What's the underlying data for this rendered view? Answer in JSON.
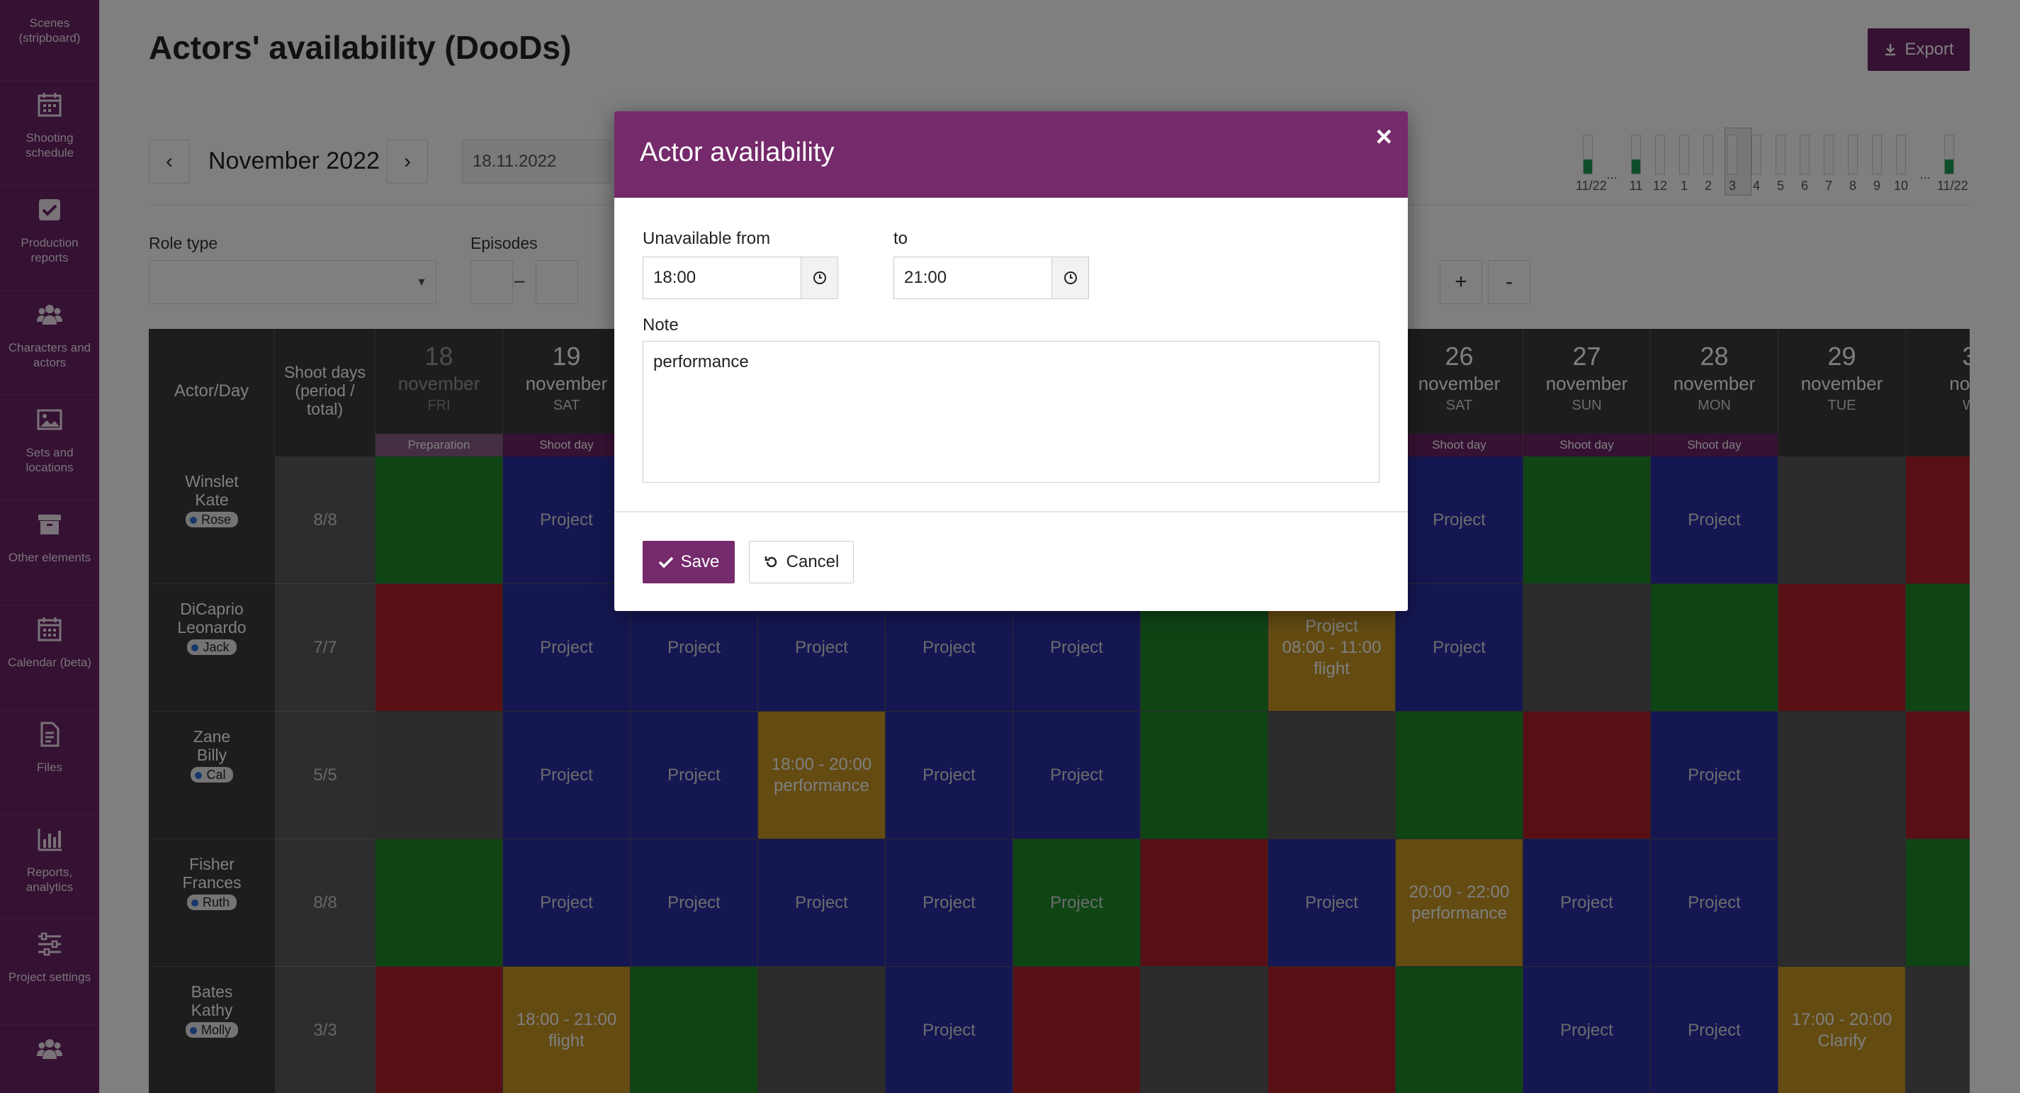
{
  "sidebar": {
    "items": [
      {
        "label": "Scenes (stripboard)",
        "icon": "stripboard-icon"
      },
      {
        "label": "Shooting schedule",
        "icon": "calendar-grid-icon"
      },
      {
        "label": "Production reports",
        "icon": "checkbox-icon"
      },
      {
        "label": "Characters and actors",
        "icon": "users-icon"
      },
      {
        "label": "Sets and locations",
        "icon": "image-icon"
      },
      {
        "label": "Other elements",
        "icon": "archive-box-icon"
      },
      {
        "label": "Calendar (beta)",
        "icon": "calendar-icon"
      },
      {
        "label": "Files",
        "icon": "file-icon"
      },
      {
        "label": "Reports, analytics",
        "icon": "bar-chart-icon"
      },
      {
        "label": "Project settings",
        "icon": "sliders-icon"
      },
      {
        "label": "",
        "icon": "users-icon"
      }
    ]
  },
  "page": {
    "title": "Actors' availability (DooDs)",
    "export_label": "Export",
    "month_label": "November 2022",
    "prev_label": "‹",
    "next_label": "›",
    "date_value": "18.11.2022",
    "role_type_label": "Role type",
    "episodes_label": "Episodes",
    "episode_dash": "–",
    "zoom_in_label": "+",
    "zoom_out_label": "-"
  },
  "timeline": {
    "labels": [
      "11/22",
      "...",
      "11",
      "12",
      "1",
      "2",
      "3",
      "4",
      "5",
      "6",
      "7",
      "8",
      "9",
      "10",
      "...",
      "11/22"
    ]
  },
  "grid": {
    "actor_header": "Actor/Day",
    "shootdays_header": "Shoot days (period / total)",
    "days": [
      {
        "num": "18",
        "month": "november",
        "weekday": "FRI",
        "type": "Preparation",
        "faded": true
      },
      {
        "num": "19",
        "month": "november",
        "weekday": "SAT",
        "type": "Shoot day",
        "faded": false
      },
      {
        "num": "",
        "month": "",
        "weekday": "",
        "type": "",
        "faded": false
      },
      {
        "num": "",
        "month": "",
        "weekday": "",
        "type": "",
        "faded": false
      },
      {
        "num": "",
        "month": "",
        "weekday": "",
        "type": "",
        "faded": false
      },
      {
        "num": "",
        "month": "",
        "weekday": "",
        "type": "",
        "faded": false
      },
      {
        "num": "",
        "month": "",
        "weekday": "",
        "type": "",
        "faded": false
      },
      {
        "num": "",
        "month": "",
        "weekday": "",
        "type": "",
        "faded": false
      },
      {
        "num": "26",
        "month": "november",
        "weekday": "SAT",
        "type": "Shoot day",
        "faded": false
      },
      {
        "num": "27",
        "month": "november",
        "weekday": "SUN",
        "type": "Shoot day",
        "faded": false
      },
      {
        "num": "28",
        "month": "november",
        "weekday": "MON",
        "type": "Shoot day",
        "faded": false
      },
      {
        "num": "29",
        "month": "november",
        "weekday": "TUE",
        "type": "",
        "faded": false
      },
      {
        "num": "3",
        "month": "nove",
        "weekday": "W",
        "type": "",
        "faded": false
      }
    ],
    "actors": [
      {
        "last": "Winslet",
        "first": "Kate",
        "role": "Rose",
        "shoot_days": "8/8"
      },
      {
        "last": "DiCaprio",
        "first": "Leonardo",
        "role": "Jack",
        "shoot_days": "7/7"
      },
      {
        "last": "Zane",
        "first": "Billy",
        "role": "Cal",
        "shoot_days": "5/5"
      },
      {
        "last": "Fisher",
        "first": "Frances",
        "role": "Ruth",
        "shoot_days": "8/8"
      },
      {
        "last": "Bates",
        "first": "Kathy",
        "role": "Molly",
        "shoot_days": "3/3"
      }
    ],
    "rows": [
      [
        {
          "color": "green",
          "lines": []
        },
        {
          "color": "proj",
          "lines": [
            "Project"
          ]
        },
        {
          "color": "proj",
          "lines": []
        },
        {
          "color": "proj",
          "lines": []
        },
        {
          "color": "proj",
          "lines": []
        },
        {
          "color": "proj",
          "lines": []
        },
        {
          "color": "proj",
          "lines": []
        },
        {
          "color": "proj",
          "lines": []
        },
        {
          "color": "proj",
          "lines": [
            "Project"
          ]
        },
        {
          "color": "green",
          "lines": []
        },
        {
          "color": "proj",
          "lines": [
            "Project"
          ]
        },
        {
          "color": "gray",
          "lines": []
        },
        {
          "color": "red",
          "lines": []
        }
      ],
      [
        {
          "color": "red",
          "lines": []
        },
        {
          "color": "proj",
          "lines": [
            "Project"
          ]
        },
        {
          "color": "proj",
          "lines": [
            "Project"
          ]
        },
        {
          "color": "proj",
          "lines": [
            "Project"
          ]
        },
        {
          "color": "proj",
          "lines": [
            "Project"
          ]
        },
        {
          "color": "proj",
          "lines": [
            "Project"
          ]
        },
        {
          "color": "green",
          "lines": []
        },
        {
          "color": "orange",
          "lines": [
            "Project",
            "08:00 - 11:00",
            "flight"
          ]
        },
        {
          "color": "proj",
          "lines": [
            "Project"
          ]
        },
        {
          "color": "gray",
          "lines": []
        },
        {
          "color": "green",
          "lines": []
        },
        {
          "color": "red",
          "lines": []
        },
        {
          "color": "green",
          "lines": []
        }
      ],
      [
        {
          "color": "gray",
          "lines": []
        },
        {
          "color": "proj",
          "lines": [
            "Project"
          ]
        },
        {
          "color": "proj",
          "lines": [
            "Project"
          ]
        },
        {
          "color": "orange",
          "lines": [
            "18:00 - 20:00",
            "performance"
          ]
        },
        {
          "color": "proj",
          "lines": [
            "Project"
          ]
        },
        {
          "color": "proj",
          "lines": [
            "Project"
          ]
        },
        {
          "color": "green",
          "lines": []
        },
        {
          "color": "gray",
          "lines": []
        },
        {
          "color": "green",
          "lines": []
        },
        {
          "color": "red",
          "lines": []
        },
        {
          "color": "proj",
          "lines": [
            "Project"
          ]
        },
        {
          "color": "gray",
          "lines": []
        },
        {
          "color": "red",
          "lines": []
        }
      ],
      [
        {
          "color": "green",
          "lines": []
        },
        {
          "color": "proj",
          "lines": [
            "Project"
          ]
        },
        {
          "color": "proj",
          "lines": [
            "Project"
          ]
        },
        {
          "color": "proj",
          "lines": [
            "Project"
          ]
        },
        {
          "color": "proj",
          "lines": [
            "Project"
          ]
        },
        {
          "color": "green",
          "lines": [
            "Project"
          ]
        },
        {
          "color": "red",
          "lines": []
        },
        {
          "color": "proj",
          "lines": [
            "Project"
          ]
        },
        {
          "color": "orange",
          "lines": [
            "20:00 - 22:00",
            "performance"
          ]
        },
        {
          "color": "proj",
          "lines": [
            "Project"
          ]
        },
        {
          "color": "proj",
          "lines": [
            "Project"
          ]
        },
        {
          "color": "gray",
          "lines": []
        },
        {
          "color": "green",
          "lines": []
        }
      ],
      [
        {
          "color": "red",
          "lines": []
        },
        {
          "color": "orange",
          "lines": [
            "18:00 - 21:00",
            "flight"
          ]
        },
        {
          "color": "green",
          "lines": []
        },
        {
          "color": "gray",
          "lines": []
        },
        {
          "color": "proj",
          "lines": [
            "Project"
          ]
        },
        {
          "color": "red",
          "lines": []
        },
        {
          "color": "gray",
          "lines": []
        },
        {
          "color": "red",
          "lines": []
        },
        {
          "color": "green",
          "lines": []
        },
        {
          "color": "proj",
          "lines": [
            "Project"
          ]
        },
        {
          "color": "proj",
          "lines": [
            "Project"
          ]
        },
        {
          "color": "orange",
          "lines": [
            "17:00 - 20:00",
            "Clarify"
          ]
        },
        {
          "color": "gray",
          "lines": []
        }
      ]
    ]
  },
  "modal": {
    "title": "Actor availability",
    "close_label": "×",
    "from_label": "Unavailable from",
    "from_value": "18:00",
    "to_label": "to",
    "to_value": "21:00",
    "note_label": "Note",
    "note_value": "performance",
    "save_label": "Save",
    "cancel_label": "Cancel"
  },
  "colors": {
    "brand": "#752a6b",
    "project": "#2b2fa6",
    "available": "#1f8b2a",
    "unavailable": "#b3202a",
    "partial": "#c79624"
  }
}
